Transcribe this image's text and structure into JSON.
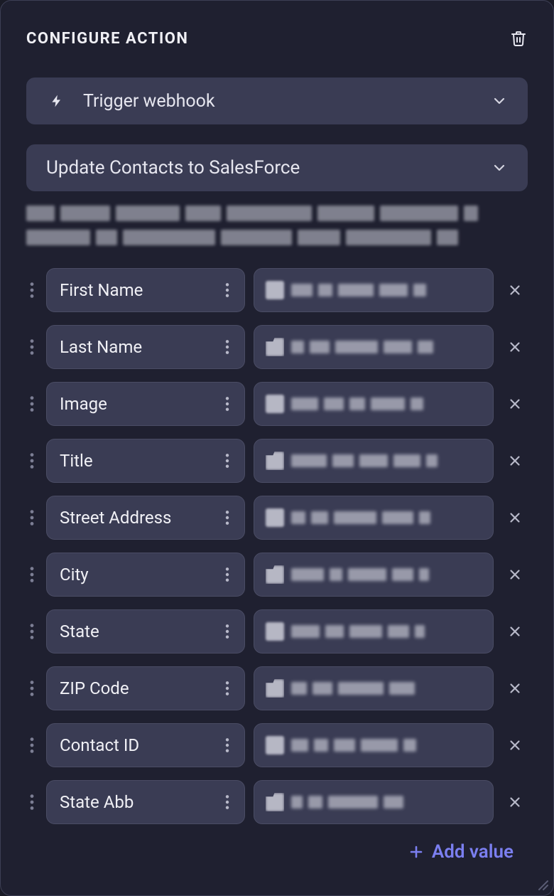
{
  "header": {
    "title": "CONFIGURE ACTION"
  },
  "trigger": {
    "label": "Trigger webhook"
  },
  "action": {
    "label": "Update Contacts to SalesForce"
  },
  "fields": [
    {
      "label": "First Name"
    },
    {
      "label": "Last Name"
    },
    {
      "label": "Image"
    },
    {
      "label": "Title"
    },
    {
      "label": "Street Address"
    },
    {
      "label": "City"
    },
    {
      "label": "State"
    },
    {
      "label": "ZIP Code"
    },
    {
      "label": "Contact ID"
    },
    {
      "label": "State Abb"
    }
  ],
  "addValue": {
    "label": "Add value"
  }
}
